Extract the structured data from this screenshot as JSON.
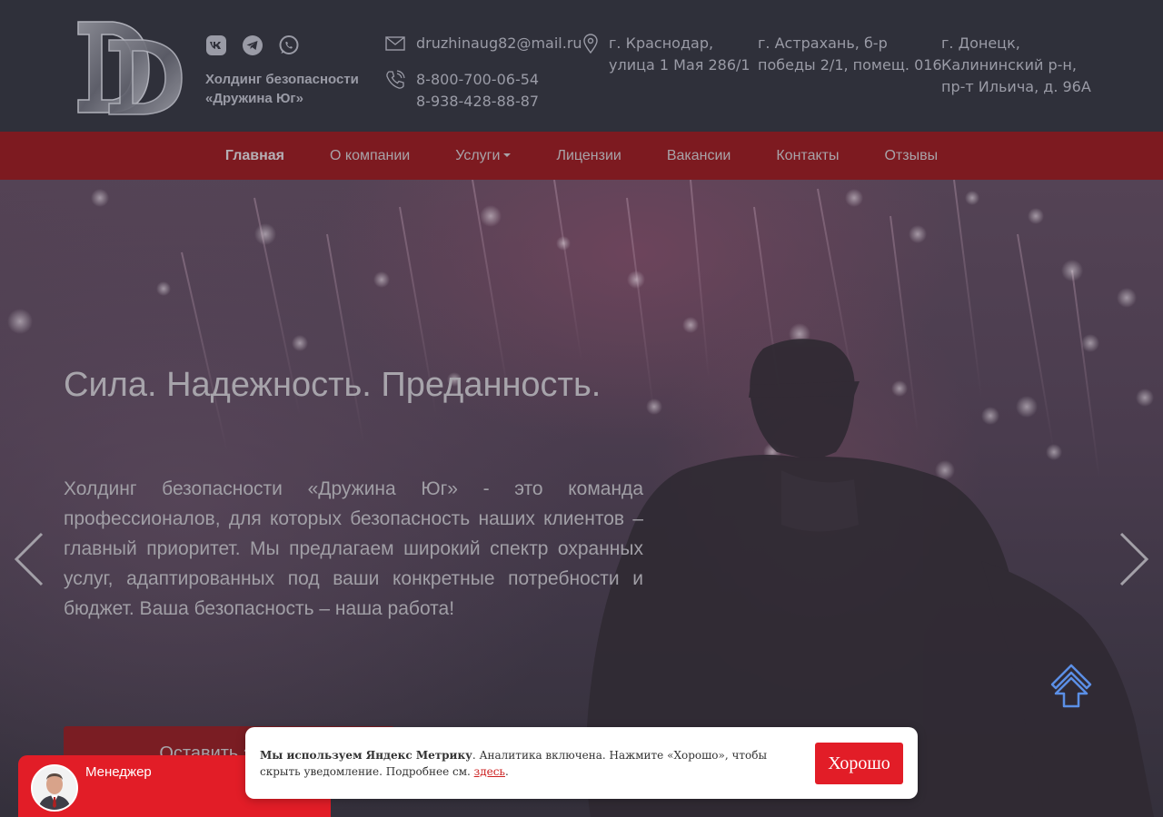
{
  "header": {
    "logo_icon": "dd-monogram-logo",
    "socials": [
      {
        "icon": "vk-icon"
      },
      {
        "icon": "telegram-icon"
      },
      {
        "icon": "whatsapp-icon"
      }
    ],
    "company_line1": "Холдинг безопасности",
    "company_line2": "«Дружина Юг»",
    "email": "druzhinaug82@mail.ru",
    "phone1": "8-800-700-06-54",
    "phone2": "8-938-428-88-87",
    "address1_line1": "г. Краснодар,",
    "address1_line2": "улица 1 Мая 286/1",
    "address2_line1": "г. Астрахань, б-р",
    "address2_line2": "победы 2/1, помещ. 016",
    "address3_line1": "г. Донецк,",
    "address3_line2": "Калининский р-н,",
    "address3_line3": "пр-т Ильича, д. 96А"
  },
  "nav": {
    "items": [
      {
        "label": "Главная",
        "active": true
      },
      {
        "label": "О компании"
      },
      {
        "label": "Услуги",
        "dropdown": true
      },
      {
        "label": "Лицензии"
      },
      {
        "label": "Вакансии"
      },
      {
        "label": "Контакты"
      },
      {
        "label": "Отзывы"
      }
    ]
  },
  "hero": {
    "title": "Сила. Надежность. Преданность.",
    "text": "Холдинг безопасности «Дружина Юг» - это команда профессионалов, для которых безопасность наших клиентов – главный приоритет. Мы предлагаем широкий спектр охранных услуг, адаптированных под ваши конкретные потребности и бюджет. Ваша безопасность – наша работа!",
    "cta_label": "Оставить заявку"
  },
  "manager_widget": {
    "label": "Менеджер"
  },
  "cookie": {
    "bold": "Мы используем Яндекс Метрику",
    "text": ". Аналитика включена. Нажмите «Хорошо», чтобы скрыть уведомление. Подробнее см. ",
    "link": "здесь",
    "end": ".",
    "button": "Хорошо"
  },
  "colors": {
    "header_bg": "#2f303a",
    "nav_bg": "#7d1a20",
    "accent_red": "#e21d27",
    "scroll_top_arrow": "#5b8fe6"
  }
}
